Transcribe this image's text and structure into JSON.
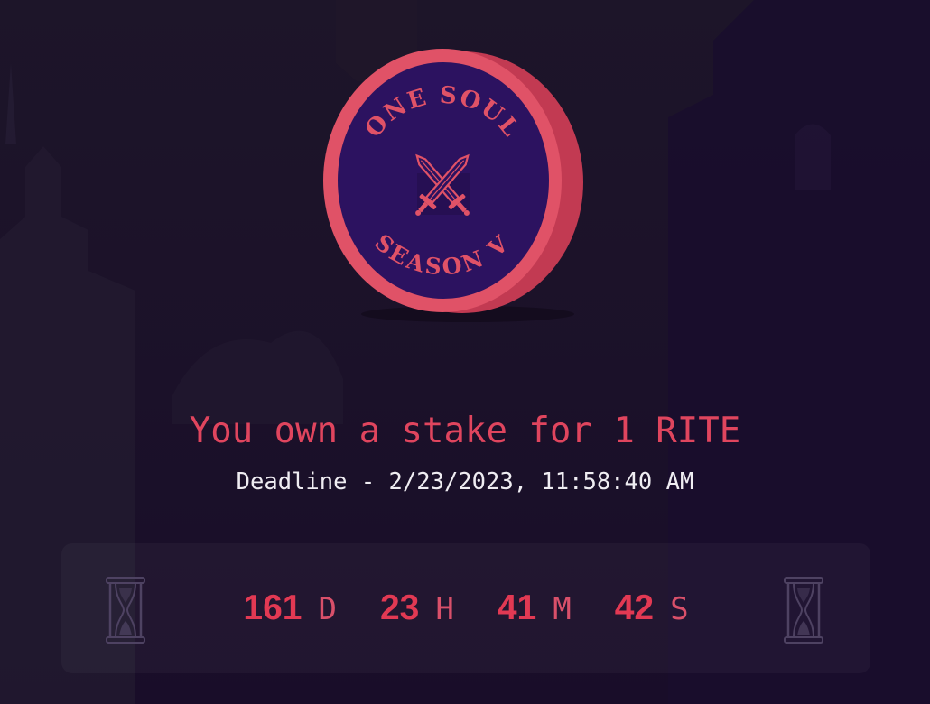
{
  "coin": {
    "top_text": "ONE SOUL",
    "bottom_text": "SEASON V",
    "center_icon": "crossed-swords-icon",
    "colors": {
      "rim": "#e05267",
      "edge": "#c23a52",
      "face": "#2c1260"
    }
  },
  "stake": {
    "message": "You own a stake for 1 RITE",
    "deadline": "Deadline - 2/23/2023, 11:58:40 AM"
  },
  "countdown": {
    "left_icon": "hourglass-icon",
    "right_icon": "hourglass-icon",
    "units": [
      {
        "value": "161",
        "unit": "D"
      },
      {
        "value": "23",
        "unit": "H"
      },
      {
        "value": "41",
        "unit": "M"
      },
      {
        "value": "42",
        "unit": "S"
      }
    ]
  },
  "colors": {
    "background": "#1b1129",
    "accent": "#e0455e",
    "countdown_value": "#e23953",
    "text": "#efedf2",
    "icon_muted": "#4e4262"
  }
}
